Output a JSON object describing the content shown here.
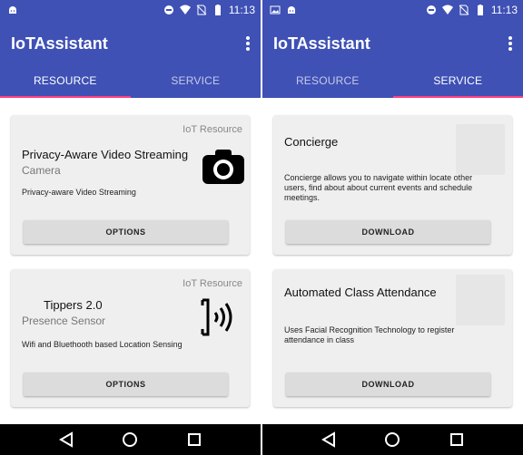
{
  "left": {
    "status_time": "11:13",
    "app_title": "IoTAssistant",
    "tabs": [
      {
        "label": "RESOURCE"
      },
      {
        "label": "SERVICE"
      }
    ],
    "active_tab": 0,
    "cards": [
      {
        "category": "IoT Resource",
        "title": "Privacy-Aware Video Streaming",
        "subtitle": "Camera",
        "description": "Privacy-aware Video Streaming",
        "button": "OPTIONS",
        "icon": "camera-icon"
      },
      {
        "category": "IoT Resource",
        "title": "Tippers 2.0",
        "subtitle": "Presence Sensor",
        "description": "Wifi and Bluethooth based Location Sensing",
        "button": "OPTIONS",
        "icon": "nfc-signal-icon"
      }
    ]
  },
  "right": {
    "status_time": "11:13",
    "app_title": "IoTAssistant",
    "tabs": [
      {
        "label": "RESOURCE"
      },
      {
        "label": "SERVICE"
      }
    ],
    "active_tab": 1,
    "cards": [
      {
        "title": "Concierge",
        "description": "Concierge allows you to navigate within locate other users, find about about current events and schedule meetings.",
        "button": "DOWNLOAD"
      },
      {
        "title": "Automated Class Attendance",
        "description": "Uses Facial Recognition Technology to register attendance in class",
        "button": "DOWNLOAD"
      }
    ]
  },
  "colors": {
    "primary": "#3f51b5",
    "accent": "#ff4081",
    "card": "#efefef",
    "button": "#dcdcdc"
  }
}
